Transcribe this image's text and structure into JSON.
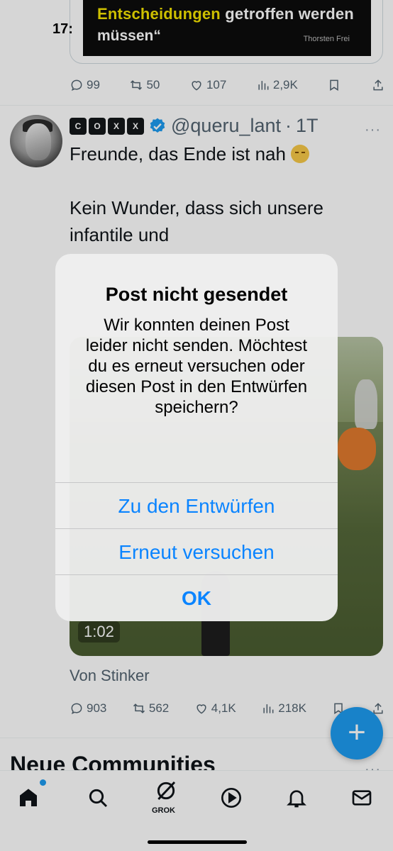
{
  "status_bar": {
    "time": "17:"
  },
  "embedded_card": {
    "headline_highlight": "Entscheidungen",
    "headline_rest": " getroffen werden",
    "headline_line2": "müssen“",
    "credit": "Thorsten Frei"
  },
  "prev_post_actions": {
    "replies": "99",
    "reposts": "50",
    "likes": "107",
    "views": "2,9K"
  },
  "post": {
    "badge_letters": [
      "C",
      "O",
      "X",
      "X"
    ],
    "handle": "@queru_lant",
    "separator": "·",
    "age": "1T",
    "more": "···",
    "line1": "Freunde, das Ende ist nah",
    "line2": "Kein Wunder, dass sich unsere",
    "line3": "infantile und",
    "video_duration": "1:02",
    "source": "Von Stinker",
    "actions": {
      "replies": "903",
      "reposts": "562",
      "likes": "4,1K",
      "views": "218K"
    }
  },
  "section": {
    "title": "Neue Communities",
    "more": "···"
  },
  "fab": {
    "label": "+"
  },
  "tabbar": {
    "grok_label": "GROK"
  },
  "alert": {
    "title": "Post nicht gesendet",
    "message": "Wir konnten deinen Post leider nicht senden. Möchtest du es erneut versuchen oder diesen Post in den Entwürfen speichern?",
    "button_drafts": "Zu den Entwürfen",
    "button_retry": "Erneut versuchen",
    "button_ok": "OK"
  },
  "colors": {
    "accent": "#1d9bf0",
    "alert_button": "#0a84ff",
    "secondary_text": "#536471"
  }
}
